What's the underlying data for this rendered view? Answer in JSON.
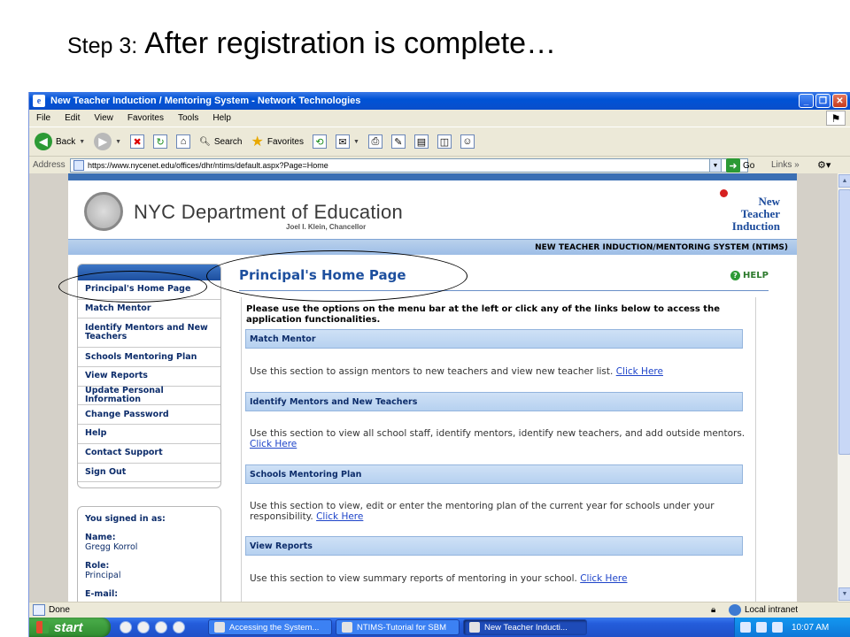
{
  "slide": {
    "step": "Step 3:",
    "title": "After registration is complete…"
  },
  "window": {
    "title": "New Teacher Induction / Mentoring System - Network Technologies",
    "controls": {
      "minimize": "_",
      "maximize": "❐",
      "close": "✕"
    }
  },
  "menu": [
    "File",
    "Edit",
    "View",
    "Favorites",
    "Tools",
    "Help"
  ],
  "toolbar": {
    "back": "Back",
    "search": "Search",
    "favorites": "Favorites"
  },
  "address": {
    "label": "Address",
    "url": "https://www.nycenet.edu/offices/dhr/ntims/default.aspx?Page=Home",
    "go": "Go",
    "links": "Links"
  },
  "site": {
    "org": "NYC Department of Education",
    "chancellor": "Joel I. Klein, Chancellor",
    "logo": {
      "line1": "New",
      "line2": "Teacher",
      "line3": "Induction"
    },
    "system": "NEW TEACHER INDUCTION/MENTORING SYSTEM (NTIMS)"
  },
  "nav": {
    "items": [
      "Principal's Home Page",
      "Match Mentor",
      "Identify Mentors and New Teachers",
      "Schools Mentoring Plan",
      "View Reports",
      "Update Personal Information",
      "Change Password",
      "Help",
      "Contact Support",
      "Sign Out"
    ]
  },
  "signed_in": {
    "heading": "You signed in as:",
    "name_label": "Name:",
    "name": "Gregg Korrol",
    "role_label": "Role:",
    "role": "Principal",
    "email_label": "E-mail:"
  },
  "main": {
    "title": "Principal's Home Page",
    "help": "HELP",
    "intro": "Please use the options on the menu bar at the left or click any of the links below to access the application functionalities.",
    "sections": [
      {
        "header": "Match Mentor",
        "text": "Use this section to assign mentors to new teachers and view new teacher list.",
        "link": "Click Here"
      },
      {
        "header": "Identify Mentors and New Teachers",
        "text": "Use this section to view all school staff, identify mentors, identify new teachers, and add outside mentors.",
        "link": "Click Here"
      },
      {
        "header": "Schools Mentoring Plan",
        "text": "Use this section to view, edit or enter the mentoring plan of the current year for schools under your responsibility.",
        "link": "Click Here"
      },
      {
        "header": "View Reports",
        "text": "Use this section to view summary reports of mentoring in your school.",
        "link": "Click Here"
      }
    ]
  },
  "status": {
    "text": "Done",
    "zone": "Local intranet"
  },
  "taskbar": {
    "start": "start",
    "tasks": [
      "Accessing the System...",
      "NTIMS-Tutorial for SBM",
      "New Teacher Inducti..."
    ],
    "clock": "10:07 AM"
  }
}
